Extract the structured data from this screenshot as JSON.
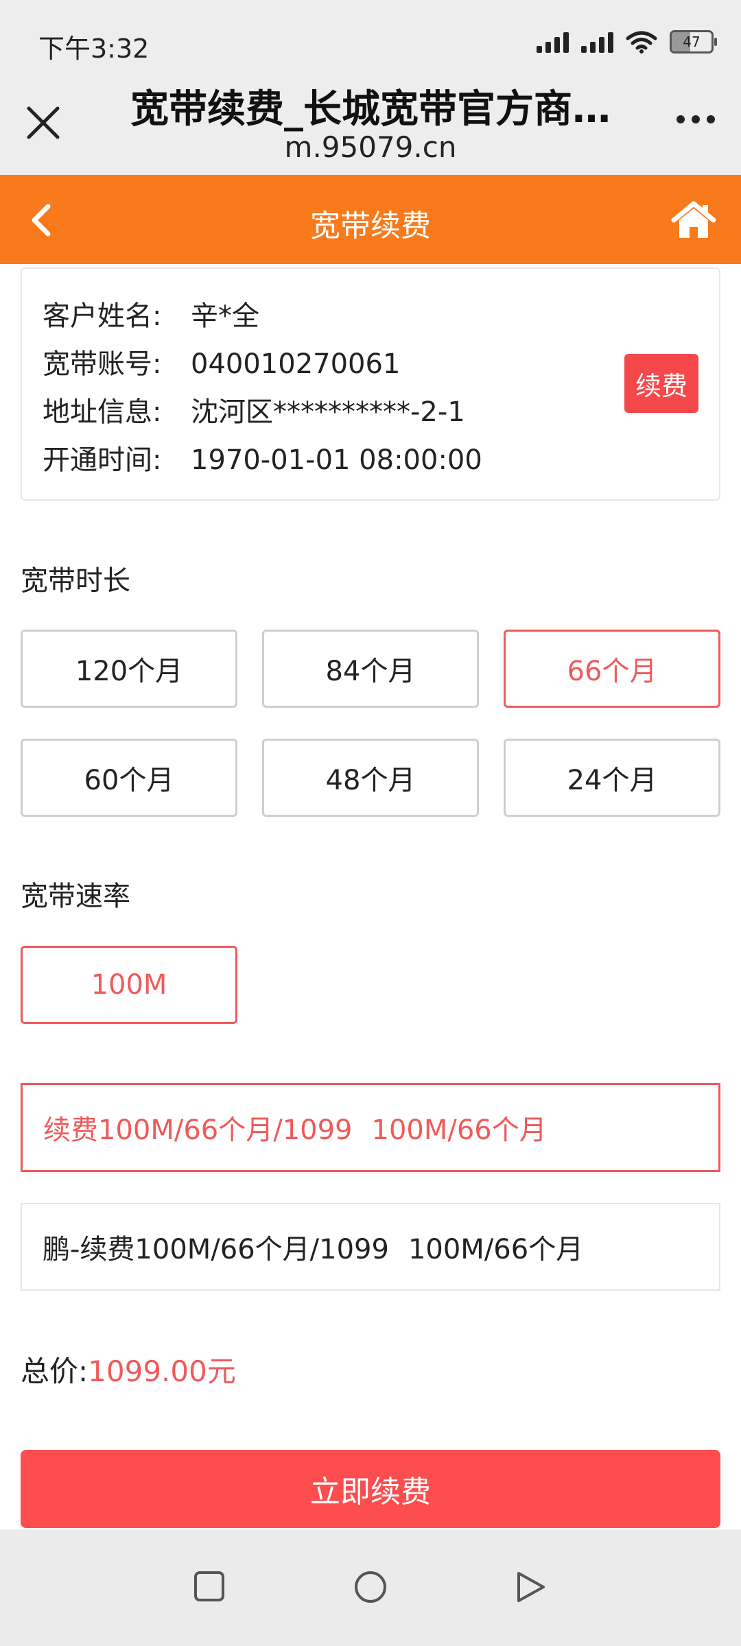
{
  "status_bar": {
    "time": "下午3:32",
    "battery_level": "47",
    "icons": [
      "signal-icon",
      "signal-icon",
      "wifi-icon",
      "battery-icon"
    ]
  },
  "browser": {
    "title": "宽带续费_长城宽带官方商…",
    "url": "m.95079.cn",
    "icons": [
      "close-icon",
      "more-icon"
    ]
  },
  "header": {
    "title": "宽带续费",
    "icons": [
      "back-icon",
      "home-icon"
    ]
  },
  "customer": {
    "rows": [
      {
        "label": "客户姓名:",
        "value": "辛*全"
      },
      {
        "label": "宽带账号:",
        "value": "040010270061"
      },
      {
        "label": "地址信息:",
        "value": "沈河区**********-2-1"
      },
      {
        "label": "开通时间:",
        "value": "1970-01-01 08:00:00"
      }
    ],
    "renew_badge": "续费"
  },
  "duration": {
    "title": "宽带时长",
    "options": [
      "120个月",
      "84个月",
      "66个月",
      "60个月",
      "48个月",
      "24个月"
    ],
    "selected": "66个月"
  },
  "speed": {
    "title": "宽带速率",
    "options": [
      "100M"
    ],
    "selected": "100M"
  },
  "packages": [
    {
      "name": "续费100M/66个月/1099",
      "desc": "100M/66个月",
      "selected": true
    },
    {
      "name": "鹏-续费100M/66个月/1099",
      "desc": "100M/66个月",
      "selected": false
    }
  ],
  "total": {
    "label": "总价:",
    "value": "1099.00元"
  },
  "submit_label": "立即续费",
  "accent_colors": {
    "header": "#f97a1b",
    "highlight": "#f05a5a",
    "button": "#fd4d4f"
  }
}
